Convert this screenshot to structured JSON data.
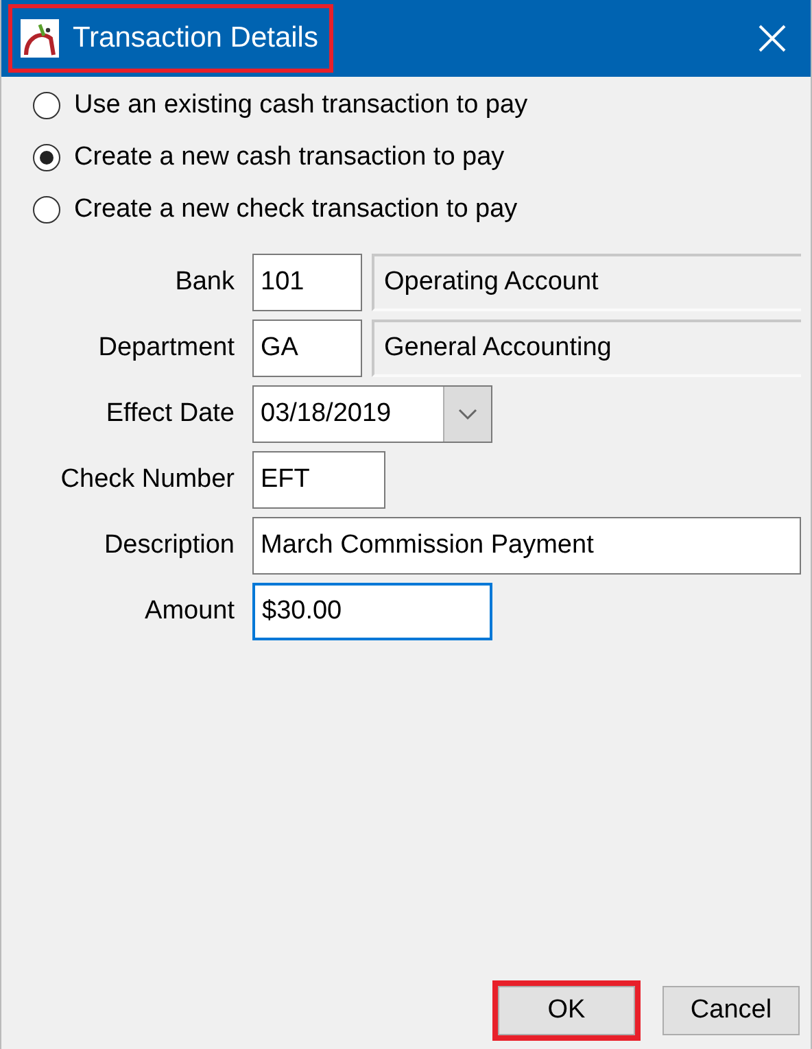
{
  "window": {
    "title": "Transaction Details",
    "highlighted": true
  },
  "payment_options": [
    {
      "label": "Use an existing cash transaction to pay",
      "selected": false
    },
    {
      "label": "Create a new cash transaction to pay",
      "selected": true
    },
    {
      "label": "Create a new check transaction to pay",
      "selected": false
    }
  ],
  "fields": [
    {
      "label": "Bank",
      "kind": "lookup",
      "value": "101",
      "lookup": "Operating Account",
      "focused": false
    },
    {
      "label": "Department",
      "kind": "lookup",
      "value": "GA",
      "lookup": "General Accounting",
      "focused": false
    },
    {
      "label": "Effect Date",
      "kind": "date",
      "value": "03/18/2019",
      "focused": false
    },
    {
      "label": "Check Number",
      "kind": "short",
      "value": "EFT",
      "focused": false
    },
    {
      "label": "Description",
      "kind": "wide",
      "value": "March Commission Payment",
      "focused": false
    },
    {
      "label": "Amount",
      "kind": "medium",
      "value": "$30.00",
      "focused": true
    }
  ],
  "buttons": [
    {
      "label": "OK",
      "highlighted": true
    },
    {
      "label": "Cancel",
      "highlighted": false
    }
  ]
}
